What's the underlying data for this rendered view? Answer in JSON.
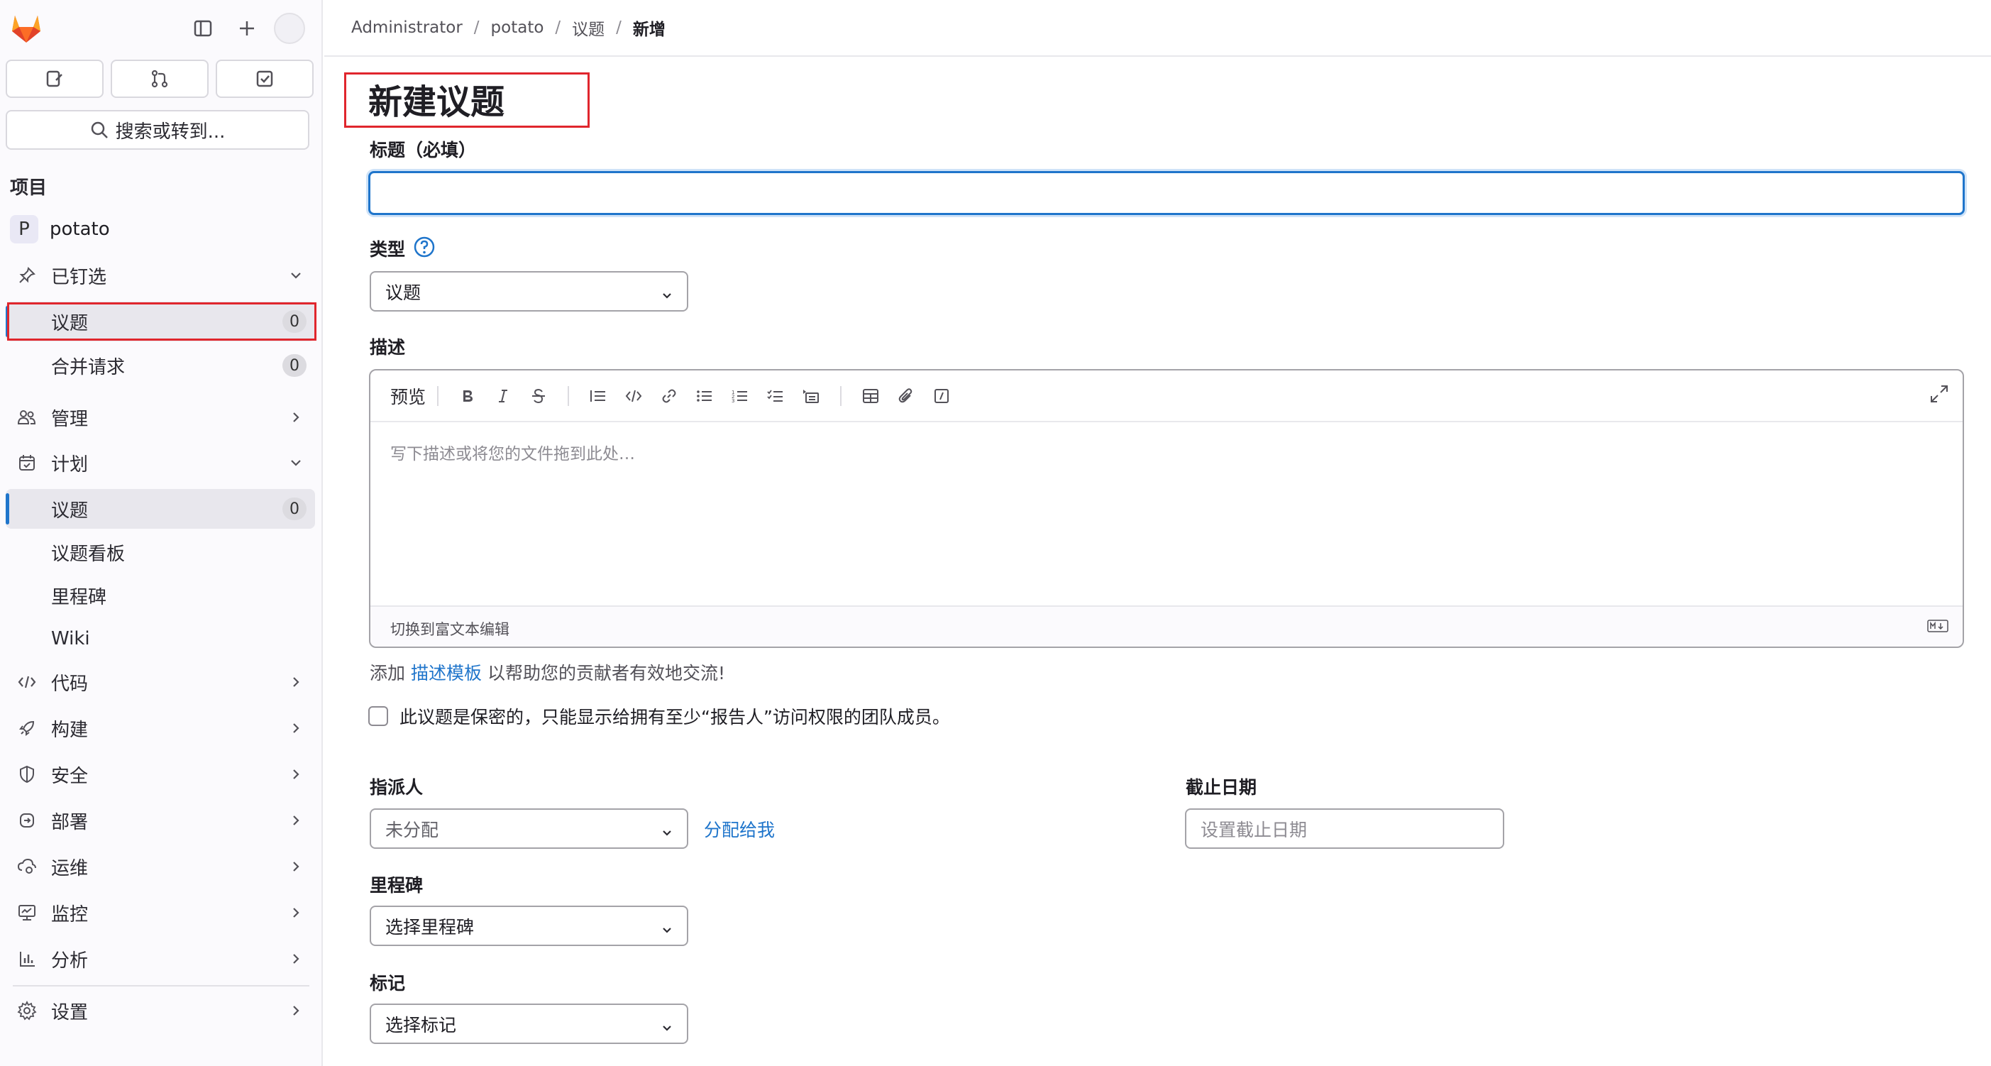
{
  "sidebar": {
    "search_label": "搜索或转到...",
    "section_title": "项目",
    "project_initial": "P",
    "project_name": "potato",
    "pinned_label": "已钉选",
    "pinned_items": [
      {
        "label": "议题",
        "count": "0"
      },
      {
        "label": "合并请求",
        "count": "0"
      }
    ],
    "manage_label": "管理",
    "plan_label": "计划",
    "plan_items": [
      {
        "label": "议题",
        "count": "0"
      },
      {
        "label": "议题看板"
      },
      {
        "label": "里程碑"
      },
      {
        "label": "Wiki"
      }
    ],
    "code_label": "代码",
    "build_label": "构建",
    "secure_label": "安全",
    "deploy_label": "部署",
    "operate_label": "运维",
    "monitor_label": "监控",
    "analyze_label": "分析",
    "settings_label": "设置"
  },
  "breadcrumb": [
    "Administrator",
    "potato",
    "议题",
    "新增"
  ],
  "page_title": "新建议题",
  "form": {
    "title_label": "标题（必填）",
    "type_label": "类型",
    "type_value": "议题",
    "description_label": "描述",
    "preview_tab": "预览",
    "description_placeholder": "写下描述或将您的文件拖到此处…",
    "switch_rich_text": "切换到富文本编辑",
    "template_prefix": "添加",
    "template_link": "描述模板",
    "template_suffix": "以帮助您的贡献者有效地交流!",
    "confidential_text": "此议题是保密的，只能显示给拥有至少“报告人”访问权限的团队成员。",
    "assignee_label": "指派人",
    "assignee_value": "未分配",
    "assign_to_me": "分配给我",
    "due_date_label": "截止日期",
    "due_date_placeholder": "设置截止日期",
    "milestone_label": "里程碑",
    "milestone_value": "选择里程碑",
    "labels_label": "标记",
    "labels_value": "选择标记"
  }
}
